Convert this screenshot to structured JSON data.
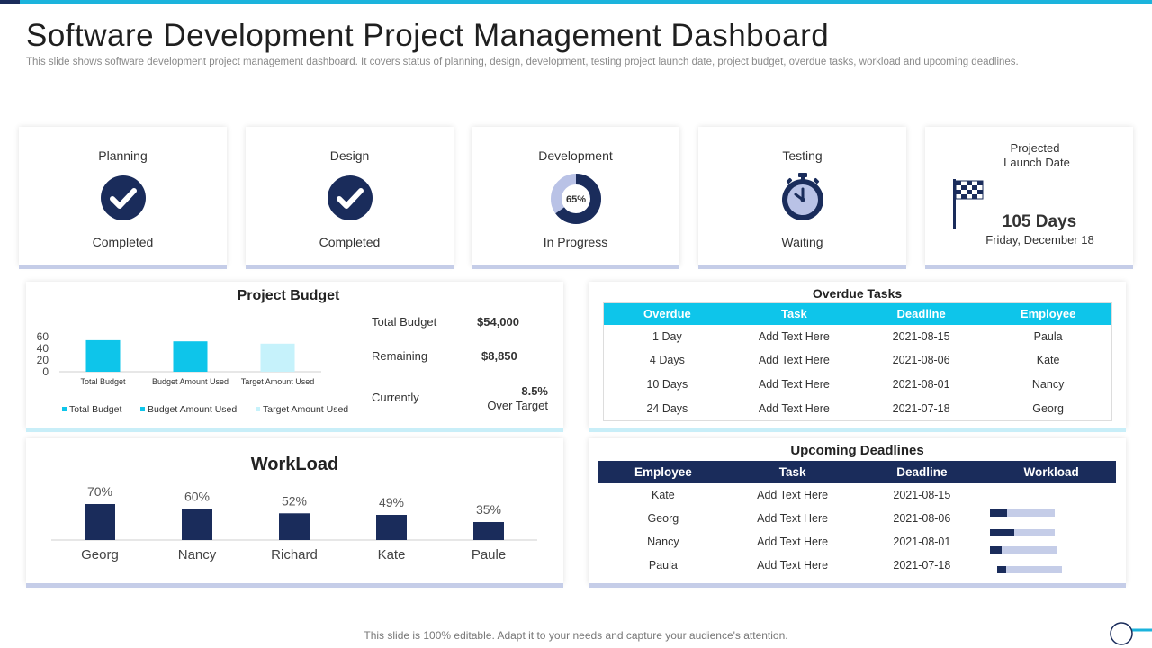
{
  "header": {
    "title": "Software Development Project Management Dashboard",
    "subtitle": "This slide shows software development project management dashboard. It covers status of planning, design, development, testing project launch date, project budget, overdue tasks, workload and upcoming deadlines."
  },
  "status_cards": [
    {
      "title": "Planning",
      "status": "Completed",
      "icon": "check-circle-icon"
    },
    {
      "title": "Design",
      "status": "Completed",
      "icon": "check-circle-icon"
    },
    {
      "title": "Development",
      "status": "In Progress",
      "icon": "donut-progress-icon",
      "progress_label": "65%",
      "progress": 0.65
    },
    {
      "title": "Testing",
      "status": "Waiting",
      "icon": "stopwatch-icon"
    }
  ],
  "launch": {
    "title_line1": "Projected",
    "title_line2": "Launch Date",
    "days": "105 Days",
    "date": "Friday, December 18",
    "icon": "checkered-flag-icon"
  },
  "budget": {
    "title": "Project Budget",
    "total_label": "Total Budget",
    "total_value": "$54,000",
    "remaining_label": "Remaining",
    "remaining_value": "$8,850",
    "currently_label": "Currently",
    "currently_value": "8.5%",
    "currently_note": "Over Target"
  },
  "chart_data": [
    {
      "type": "bar",
      "categories": [
        "Total Budget",
        "Budget Amount Used",
        "Target Amount Used"
      ],
      "values": [
        54,
        52,
        48
      ],
      "ylim": [
        0,
        60
      ],
      "yticks": [
        "0",
        "20",
        "40",
        "60"
      ],
      "legend": [
        "Total Budget",
        "Budget Amount Used",
        "Target Amount Used"
      ],
      "colors": [
        "#0ec5ea",
        "#0ec5ea",
        "#c6f2fb"
      ]
    },
    {
      "type": "bar",
      "title": "WorkLoad",
      "categories": [
        "Georg",
        "Nancy",
        "Richard",
        "Kate",
        "Paule"
      ],
      "values": [
        70,
        60,
        52,
        49,
        35
      ],
      "labels": [
        "70%",
        "60%",
        "52%",
        "49%",
        "35%"
      ],
      "color": "#1a2c5b"
    }
  ],
  "overdue": {
    "title": "Overdue Tasks",
    "headers": [
      "Overdue",
      "Task",
      "Deadline",
      "Employee"
    ],
    "rows": [
      [
        "1 Day",
        "Add Text Here",
        "2021-08-15",
        "Paula"
      ],
      [
        "4 Days",
        "Add Text Here",
        "2021-08-06",
        "Kate"
      ],
      [
        "10 Days",
        "Add Text Here",
        "2021-08-01",
        "Nancy"
      ],
      [
        "24 Days",
        "Add Text Here",
        "2021-07-18",
        "Georg"
      ]
    ]
  },
  "upcoming": {
    "title": "Upcoming Deadlines",
    "headers": [
      "Employee",
      "Task",
      "Deadline",
      "Workload"
    ],
    "rows": [
      [
        "Kate",
        "Add Text Here",
        "2021-08-15"
      ],
      [
        "Georg",
        "Add Text Here",
        "2021-08-06"
      ],
      [
        "Nancy",
        "Add Text Here",
        "2021-08-01"
      ],
      [
        "Paula",
        "Add Text Here",
        "2021-07-18"
      ]
    ],
    "workload": [
      null,
      0.27,
      0.37,
      0.17,
      0.14
    ]
  },
  "footer": "This slide is 100% editable. Adapt it to your needs and capture your audience's attention.",
  "colors": {
    "navy": "#1a2c5b",
    "cyan": "#0ec5ea",
    "light_blue": "#c5cde8"
  }
}
